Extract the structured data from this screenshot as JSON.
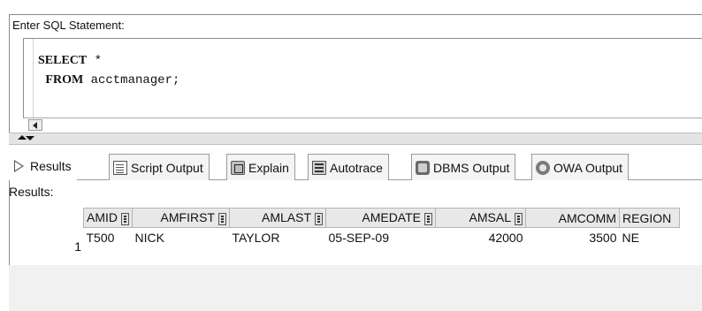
{
  "editor": {
    "label": "Enter SQL Statement:",
    "line1_keyword": "SELECT",
    "line1_rest": " *",
    "line2_keyword": "FROM",
    "line2_rest": " acctmanager;"
  },
  "tabs": [
    {
      "label": "Results",
      "icon": "play-icon",
      "active": true
    },
    {
      "label": "Script Output",
      "icon": "script-output-icon"
    },
    {
      "label": "Explain",
      "icon": "explain-icon"
    },
    {
      "label": "Autotrace",
      "icon": "autotrace-icon"
    },
    {
      "label": "DBMS Output",
      "icon": "dbms-output-icon"
    },
    {
      "label": "OWA Output",
      "icon": "owa-output-icon"
    }
  ],
  "results": {
    "label": "Results:",
    "columns": [
      "AMID",
      "AMFIRST",
      "AMLAST",
      "AMEDATE",
      "AMSAL",
      "AMCOMM",
      "REGION"
    ],
    "rows": [
      {
        "num": "1",
        "cells": [
          "T500",
          "NICK",
          "TAYLOR",
          "05-SEP-09",
          "42000",
          "3500",
          "NE"
        ]
      }
    ]
  }
}
